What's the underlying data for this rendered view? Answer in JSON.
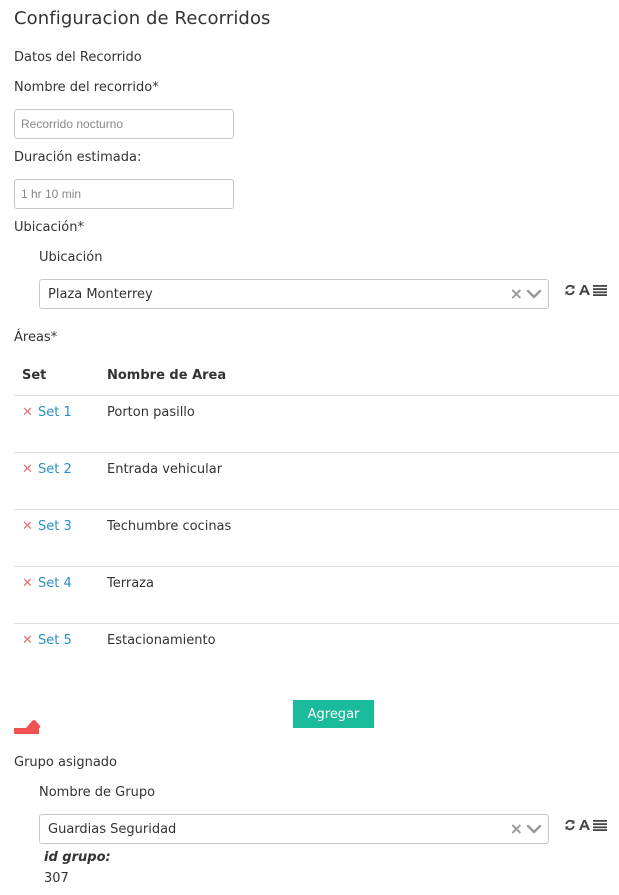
{
  "page": {
    "title": "Configuracion de Recorridos"
  },
  "datos": {
    "section_label": "Datos del Recorrido",
    "nombre_label": "Nombre del recorrido*",
    "nombre_placeholder": "Recorrido nocturno",
    "duracion_label": "Duración estimada:",
    "duracion_placeholder": "1 hr 10 min"
  },
  "ubicacion": {
    "section_label": "Ubicación*",
    "field_label": "Ubicación",
    "selected": "Plaza Monterrey"
  },
  "areas": {
    "section_label": "Áreas*",
    "columns": [
      "Set",
      "Nombre de Area"
    ],
    "rows": [
      {
        "set": "Set 1",
        "area": "Porton pasillo"
      },
      {
        "set": "Set 2",
        "area": "Entrada vehicular"
      },
      {
        "set": "Set 3",
        "area": "Techumbre cocinas"
      },
      {
        "set": "Set 4",
        "area": "Terraza"
      },
      {
        "set": "Set 5",
        "area": "Estacionamiento"
      }
    ],
    "add_button": "Agregar"
  },
  "grupo": {
    "section_label": "Grupo asignado",
    "field_label": "Nombre de Grupo",
    "selected": "Guardias Seguridad",
    "id_label": "id grupo:",
    "id_value": "307"
  },
  "icons": {
    "clear": "clear-x-icon",
    "dropdown": "chevron-down-icon",
    "refresh": "refresh-icon",
    "font": "font-icon",
    "list": "list-icon",
    "hand": "pointing-hand-icon"
  },
  "colors": {
    "accent": "#1aba9c",
    "link": "#2a8fc9",
    "delete": "#e57373",
    "hand": "#f05252"
  }
}
